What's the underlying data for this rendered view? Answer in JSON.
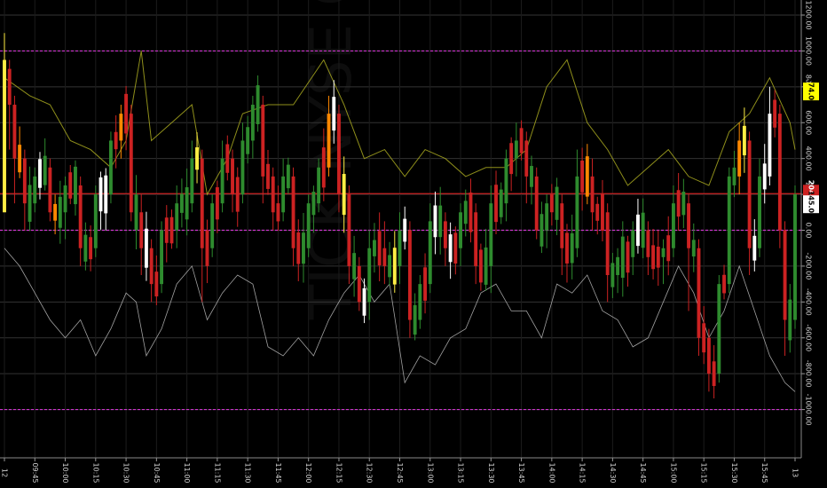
{
  "chart_data": {
    "type": "candlestick",
    "watermark": "TICK NYSE CUMULATIVE",
    "ylim": [
      -1200,
      1200
    ],
    "y_ticks": [
      1200,
      1000,
      800,
      600,
      400,
      200,
      0,
      -200,
      -400,
      -600,
      -800,
      -1000
    ],
    "y_tick_labels": [
      "1200.00",
      "1000.00",
      "800.00",
      "600.00",
      "400.00",
      "200.00",
      "0.00",
      "-200.00",
      "-400.00",
      "-600.00",
      "-800.00",
      "-1000.00"
    ],
    "x_ticks": [
      {
        "i": 0,
        "label": "12"
      },
      {
        "i": 6,
        "label": "09:45"
      },
      {
        "i": 12,
        "label": "10:00"
      },
      {
        "i": 18,
        "label": "10:15"
      },
      {
        "i": 24,
        "label": "10:30"
      },
      {
        "i": 30,
        "label": "10:45"
      },
      {
        "i": 36,
        "label": "11:00"
      },
      {
        "i": 42,
        "label": "11:15"
      },
      {
        "i": 48,
        "label": "11:30"
      },
      {
        "i": 54,
        "label": "11:45"
      },
      {
        "i": 60,
        "label": "12:00"
      },
      {
        "i": 66,
        "label": "12:15"
      },
      {
        "i": 72,
        "label": "12:30"
      },
      {
        "i": 78,
        "label": "12:45"
      },
      {
        "i": 84,
        "label": "13:00"
      },
      {
        "i": 90,
        "label": "13:15"
      },
      {
        "i": 96,
        "label": "13:30"
      },
      {
        "i": 102,
        "label": "13:45"
      },
      {
        "i": 108,
        "label": "14:00"
      },
      {
        "i": 114,
        "label": "14:15"
      },
      {
        "i": 120,
        "label": "14:30"
      },
      {
        "i": 126,
        "label": "14:45"
      },
      {
        "i": 132,
        "label": "15:00"
      },
      {
        "i": 138,
        "label": "15:15"
      },
      {
        "i": 144,
        "label": "15:30"
      },
      {
        "i": 150,
        "label": "15:45"
      },
      {
        "i": 156,
        "label": "13"
      }
    ],
    "n_bars": 157,
    "reference_lines": [
      {
        "value": 1000,
        "color": "#cc33cc",
        "style": "dashed"
      },
      {
        "value": 0,
        "color": "#cc33cc",
        "style": "dashed"
      },
      {
        "value": -1000,
        "color": "#cc33cc",
        "style": "dashed"
      },
      {
        "value": 204,
        "color": "#cc2222",
        "style": "solid"
      }
    ],
    "price_badges": [
      {
        "label": "774.00",
        "value": 774,
        "bg": "#ffff00",
        "fg": "#000000"
      },
      {
        "label": "204.00",
        "value": 204,
        "bg": "#cc2222",
        "fg": "#ffffff"
      },
      {
        "label": "145.00",
        "value": 145,
        "bg": "#ffffff",
        "fg": "#000000"
      }
    ],
    "candle_colors": {
      "up": "#2e8b2e",
      "down": "#cc2222",
      "strong_up": "#ffffff",
      "strong_down": "#ffee44",
      "orange": "#ff8800"
    },
    "anchors": [
      [
        0,
        100,
        950,
        950,
        1100,
        700,
        "strong_down"
      ],
      [
        1,
        900,
        700,
        550,
        950,
        450,
        "down"
      ],
      [
        2,
        700,
        400,
        250,
        750,
        150,
        "down"
      ],
      [
        4,
        400,
        150,
        150,
        450,
        0,
        "down"
      ],
      [
        6,
        150,
        300,
        250,
        350,
        100,
        "up"
      ],
      [
        9,
        350,
        100,
        200,
        400,
        50,
        "down"
      ],
      [
        12,
        100,
        250,
        150,
        300,
        -50,
        "up"
      ],
      [
        15,
        250,
        -100,
        50,
        300,
        -200,
        "down"
      ],
      [
        18,
        -100,
        200,
        200,
        250,
        -150,
        "up"
      ],
      [
        21,
        200,
        500,
        400,
        550,
        150,
        "up"
      ],
      [
        23,
        500,
        650,
        600,
        700,
        400,
        "orange"
      ],
      [
        25,
        650,
        100,
        200,
        700,
        50,
        "down"
      ],
      [
        27,
        100,
        -100,
        -50,
        200,
        -250,
        "down"
      ],
      [
        29,
        -100,
        -300,
        -300,
        -50,
        -400,
        "down"
      ],
      [
        31,
        -300,
        0,
        0,
        50,
        -350,
        "up"
      ],
      [
        34,
        0,
        150,
        200,
        250,
        -100,
        "up"
      ],
      [
        37,
        150,
        400,
        450,
        500,
        100,
        "up"
      ],
      [
        39,
        400,
        -100,
        -300,
        450,
        -400,
        "down"
      ],
      [
        41,
        -100,
        150,
        100,
        200,
        -150,
        "up"
      ],
      [
        43,
        150,
        400,
        450,
        500,
        100,
        "up"
      ],
      [
        45,
        400,
        200,
        300,
        450,
        100,
        "down"
      ],
      [
        47,
        200,
        500,
        450,
        600,
        150,
        "up"
      ],
      [
        49,
        500,
        700,
        650,
        750,
        400,
        "up"
      ],
      [
        51,
        700,
        300,
        400,
        750,
        150,
        "down"
      ],
      [
        53,
        300,
        100,
        150,
        350,
        0,
        "down"
      ],
      [
        55,
        100,
        300,
        250,
        400,
        50,
        "up"
      ],
      [
        57,
        300,
        -100,
        0,
        350,
        -200,
        "down"
      ],
      [
        60,
        -100,
        150,
        100,
        200,
        -150,
        "up"
      ],
      [
        62,
        150,
        350,
        300,
        400,
        100,
        "up"
      ],
      [
        64,
        350,
        650,
        700,
        750,
        300,
        "orange"
      ],
      [
        66,
        650,
        200,
        350,
        700,
        100,
        "down"
      ],
      [
        68,
        200,
        -200,
        -100,
        250,
        -300,
        "down"
      ],
      [
        70,
        -200,
        -400,
        -300,
        -150,
        -450,
        "down"
      ],
      [
        72,
        -400,
        -100,
        0,
        0,
        -500,
        "up"
      ],
      [
        75,
        -100,
        -200,
        -250,
        50,
        -300,
        "down"
      ],
      [
        78,
        -200,
        0,
        50,
        100,
        -300,
        "up"
      ],
      [
        80,
        0,
        -500,
        -400,
        50,
        -600,
        "down"
      ],
      [
        82,
        -500,
        -300,
        -350,
        -250,
        -550,
        "up"
      ],
      [
        84,
        -300,
        50,
        100,
        150,
        -350,
        "up"
      ],
      [
        87,
        50,
        -100,
        0,
        100,
        -200,
        "down"
      ],
      [
        90,
        -100,
        100,
        50,
        150,
        -200,
        "up"
      ],
      [
        93,
        100,
        -200,
        -150,
        150,
        -300,
        "down"
      ],
      [
        96,
        -200,
        150,
        100,
        250,
        -350,
        "up"
      ],
      [
        99,
        150,
        400,
        350,
        450,
        50,
        "up"
      ],
      [
        101,
        400,
        500,
        450,
        600,
        300,
        "up"
      ],
      [
        103,
        500,
        300,
        300,
        550,
        150,
        "down"
      ],
      [
        105,
        300,
        0,
        50,
        350,
        -50,
        "down"
      ],
      [
        107,
        0,
        150,
        100,
        200,
        -100,
        "up"
      ],
      [
        110,
        150,
        -100,
        -50,
        200,
        -250,
        "down"
      ],
      [
        113,
        -100,
        300,
        400,
        450,
        -150,
        "up"
      ],
      [
        116,
        300,
        100,
        150,
        400,
        0,
        "down"
      ],
      [
        119,
        100,
        -250,
        -300,
        150,
        -400,
        "down"
      ],
      [
        121,
        -250,
        -150,
        -200,
        -100,
        -350,
        "up"
      ],
      [
        124,
        -150,
        0,
        0,
        50,
        -250,
        "up"
      ],
      [
        127,
        0,
        -150,
        -200,
        50,
        -250,
        "down"
      ],
      [
        130,
        -150,
        -100,
        -100,
        -50,
        -300,
        "up"
      ],
      [
        132,
        -100,
        150,
        200,
        250,
        -150,
        "up"
      ],
      [
        135,
        150,
        -100,
        -50,
        200,
        -450,
        "down"
      ],
      [
        137,
        -100,
        -600,
        -450,
        -50,
        -700,
        "down"
      ],
      [
        139,
        -600,
        -800,
        -850,
        -550,
        -900,
        "down"
      ],
      [
        141,
        -800,
        -300,
        -400,
        -250,
        -850,
        "up"
      ],
      [
        143,
        -300,
        300,
        200,
        350,
        -350,
        "up"
      ],
      [
        145,
        300,
        500,
        550,
        600,
        200,
        "orange"
      ],
      [
        147,
        500,
        -100,
        -200,
        550,
        -250,
        "down"
      ],
      [
        149,
        -100,
        300,
        350,
        400,
        -150,
        "up"
      ],
      [
        151,
        300,
        650,
        700,
        800,
        250,
        "strong_up"
      ],
      [
        153,
        650,
        0,
        -100,
        700,
        -100,
        "down"
      ],
      [
        154,
        0,
        -500,
        -600,
        50,
        -700,
        "down"
      ],
      [
        156,
        -500,
        200,
        150,
        250,
        -550,
        "up"
      ]
    ],
    "overlay_yellow": [
      [
        0,
        850
      ],
      [
        5,
        750
      ],
      [
        9,
        700
      ],
      [
        13,
        500
      ],
      [
        17,
        450
      ],
      [
        21,
        350
      ],
      [
        24,
        500
      ],
      [
        27,
        1000
      ],
      [
        29,
        500
      ],
      [
        33,
        600
      ],
      [
        37,
        700
      ],
      [
        40,
        200
      ],
      [
        44,
        400
      ],
      [
        47,
        650
      ],
      [
        52,
        700
      ],
      [
        57,
        700
      ],
      [
        63,
        950
      ],
      [
        67,
        700
      ],
      [
        71,
        400
      ],
      [
        75,
        450
      ],
      [
        79,
        300
      ],
      [
        83,
        450
      ],
      [
        87,
        400
      ],
      [
        91,
        300
      ],
      [
        95,
        350
      ],
      [
        99,
        350
      ],
      [
        103,
        450
      ],
      [
        107,
        800
      ],
      [
        111,
        950
      ],
      [
        115,
        600
      ],
      [
        119,
        450
      ],
      [
        123,
        250
      ],
      [
        127,
        350
      ],
      [
        131,
        450
      ],
      [
        135,
        300
      ],
      [
        139,
        250
      ],
      [
        143,
        550
      ],
      [
        147,
        650
      ],
      [
        151,
        850
      ],
      [
        155,
        600
      ],
      [
        156,
        450
      ]
    ],
    "overlay_white": [
      [
        0,
        -100
      ],
      [
        3,
        -200
      ],
      [
        6,
        -350
      ],
      [
        9,
        -500
      ],
      [
        12,
        -600
      ],
      [
        15,
        -500
      ],
      [
        18,
        -700
      ],
      [
        21,
        -550
      ],
      [
        24,
        -350
      ],
      [
        26,
        -400
      ],
      [
        28,
        -700
      ],
      [
        31,
        -550
      ],
      [
        34,
        -300
      ],
      [
        37,
        -200
      ],
      [
        40,
        -500
      ],
      [
        43,
        -350
      ],
      [
        46,
        -250
      ],
      [
        49,
        -300
      ],
      [
        52,
        -650
      ],
      [
        55,
        -700
      ],
      [
        58,
        -600
      ],
      [
        61,
        -700
      ],
      [
        64,
        -500
      ],
      [
        67,
        -350
      ],
      [
        70,
        -250
      ],
      [
        73,
        -400
      ],
      [
        76,
        -300
      ],
      [
        79,
        -850
      ],
      [
        82,
        -700
      ],
      [
        85,
        -750
      ],
      [
        88,
        -600
      ],
      [
        91,
        -550
      ],
      [
        94,
        -350
      ],
      [
        97,
        -300
      ],
      [
        100,
        -450
      ],
      [
        103,
        -450
      ],
      [
        106,
        -600
      ],
      [
        109,
        -300
      ],
      [
        112,
        -350
      ],
      [
        115,
        -250
      ],
      [
        118,
        -450
      ],
      [
        121,
        -500
      ],
      [
        124,
        -650
      ],
      [
        127,
        -600
      ],
      [
        130,
        -400
      ],
      [
        133,
        -200
      ],
      [
        136,
        -350
      ],
      [
        139,
        -600
      ],
      [
        142,
        -450
      ],
      [
        145,
        -200
      ],
      [
        148,
        -450
      ],
      [
        151,
        -700
      ],
      [
        154,
        -850
      ],
      [
        156,
        -900
      ]
    ]
  }
}
